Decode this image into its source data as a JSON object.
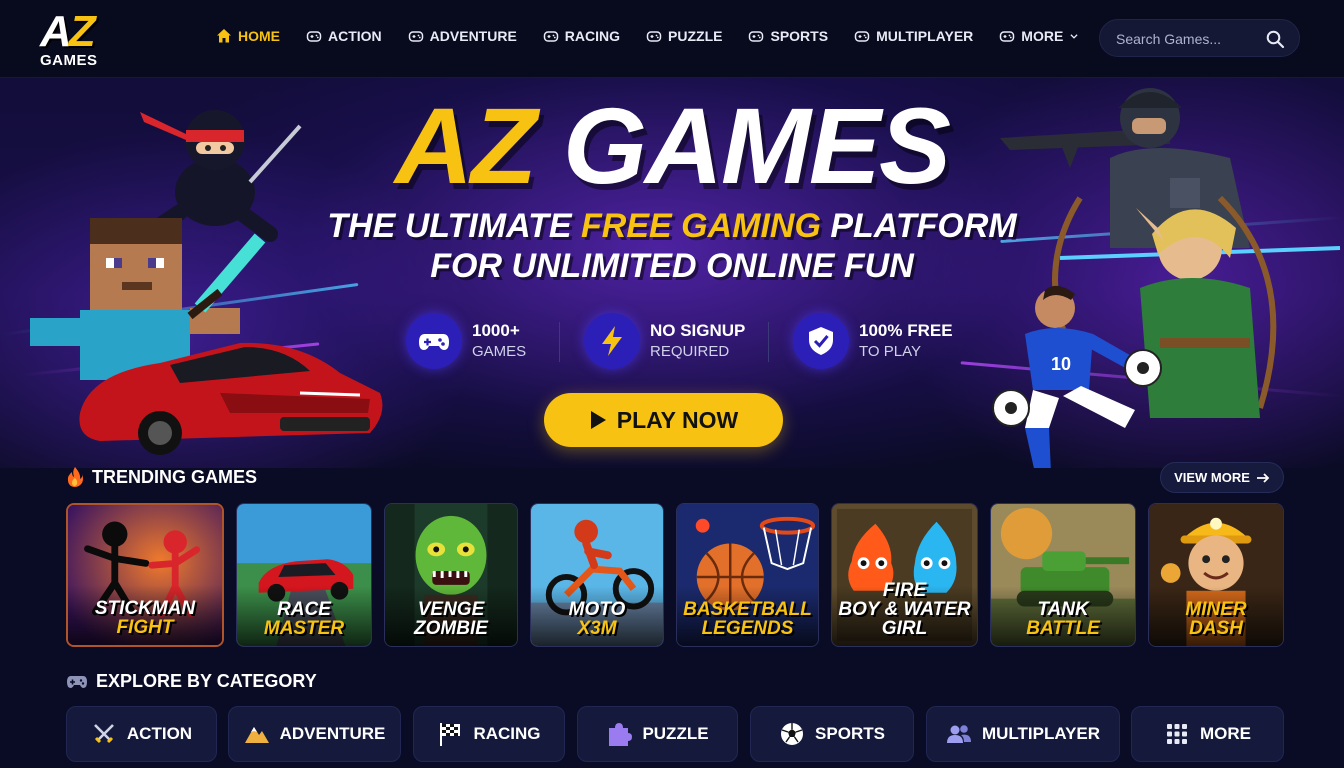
{
  "nav": {
    "logo_az_a": "A",
    "logo_az_z": "Z",
    "logo_games": "GAMES",
    "links": [
      {
        "label": "HOME",
        "icon": "home-icon",
        "active": true
      },
      {
        "label": "ACTION",
        "icon": "gamepad-icon"
      },
      {
        "label": "ADVENTURE",
        "icon": "gamepad-icon"
      },
      {
        "label": "RACING",
        "icon": "gamepad-icon"
      },
      {
        "label": "PUZZLE",
        "icon": "gamepad-icon"
      },
      {
        "label": "SPORTS",
        "icon": "gamepad-icon"
      },
      {
        "label": "MULTIPLAYER",
        "icon": "gamepad-icon"
      },
      {
        "label": "MORE",
        "icon": "gamepad-icon",
        "dropdown": true
      }
    ],
    "search_placeholder": "Search Games..."
  },
  "hero": {
    "title_part1": "AZ",
    "title_part2": "GAMES",
    "subtitle_line1_a": "THE ULTIMATE",
    "subtitle_line1_b": "FREE GAMING",
    "subtitle_line1_c": "PLATFORM",
    "subtitle_line2": "FOR UNLIMITED ONLINE FUN",
    "features": [
      {
        "main": "1000+",
        "sub": "GAMES",
        "icon": "gamepad-icon"
      },
      {
        "main": "NO SIGNUP",
        "sub": "REQUIRED",
        "icon": "lightning-icon"
      },
      {
        "main": "100% FREE",
        "sub": "TO PLAY",
        "icon": "shield-icon"
      }
    ],
    "play_label": "PLAY NOW"
  },
  "trending": {
    "title": "TRENDING GAMES",
    "view_more": "VIEW MORE",
    "games": [
      {
        "line1": "STICKMAN",
        "line2": "FIGHT"
      },
      {
        "line1": "RACE",
        "line2": "MASTER"
      },
      {
        "line1": "VENGE",
        "line2": "ZOMBIE"
      },
      {
        "line1": "MOTO",
        "line2": "X3M"
      },
      {
        "line1": "BASKETBALL",
        "line2": "LEGENDS"
      },
      {
        "line1": "FIRE",
        "line2": "BOY & WATER",
        "line3": "GIRL"
      },
      {
        "line1": "TANK",
        "line2": "BATTLE"
      },
      {
        "line1": "MINER",
        "line2": "DASH"
      }
    ]
  },
  "categories": {
    "title": "EXPLORE BY CATEGORY",
    "items": [
      {
        "label": "ACTION",
        "icon": "swords-icon"
      },
      {
        "label": "ADVENTURE",
        "icon": "mountain-icon"
      },
      {
        "label": "RACING",
        "icon": "checkered-flag-icon"
      },
      {
        "label": "PUZZLE",
        "icon": "puzzle-piece-icon"
      },
      {
        "label": "SPORTS",
        "icon": "soccer-ball-icon"
      },
      {
        "label": "MULTIPLAYER",
        "icon": "users-icon"
      },
      {
        "label": "MORE",
        "icon": "grid-icon"
      }
    ]
  },
  "colors": {
    "accent": "#f7c212",
    "background": "#0a0b24",
    "feature_icon_bg": "#2b1fb8"
  }
}
